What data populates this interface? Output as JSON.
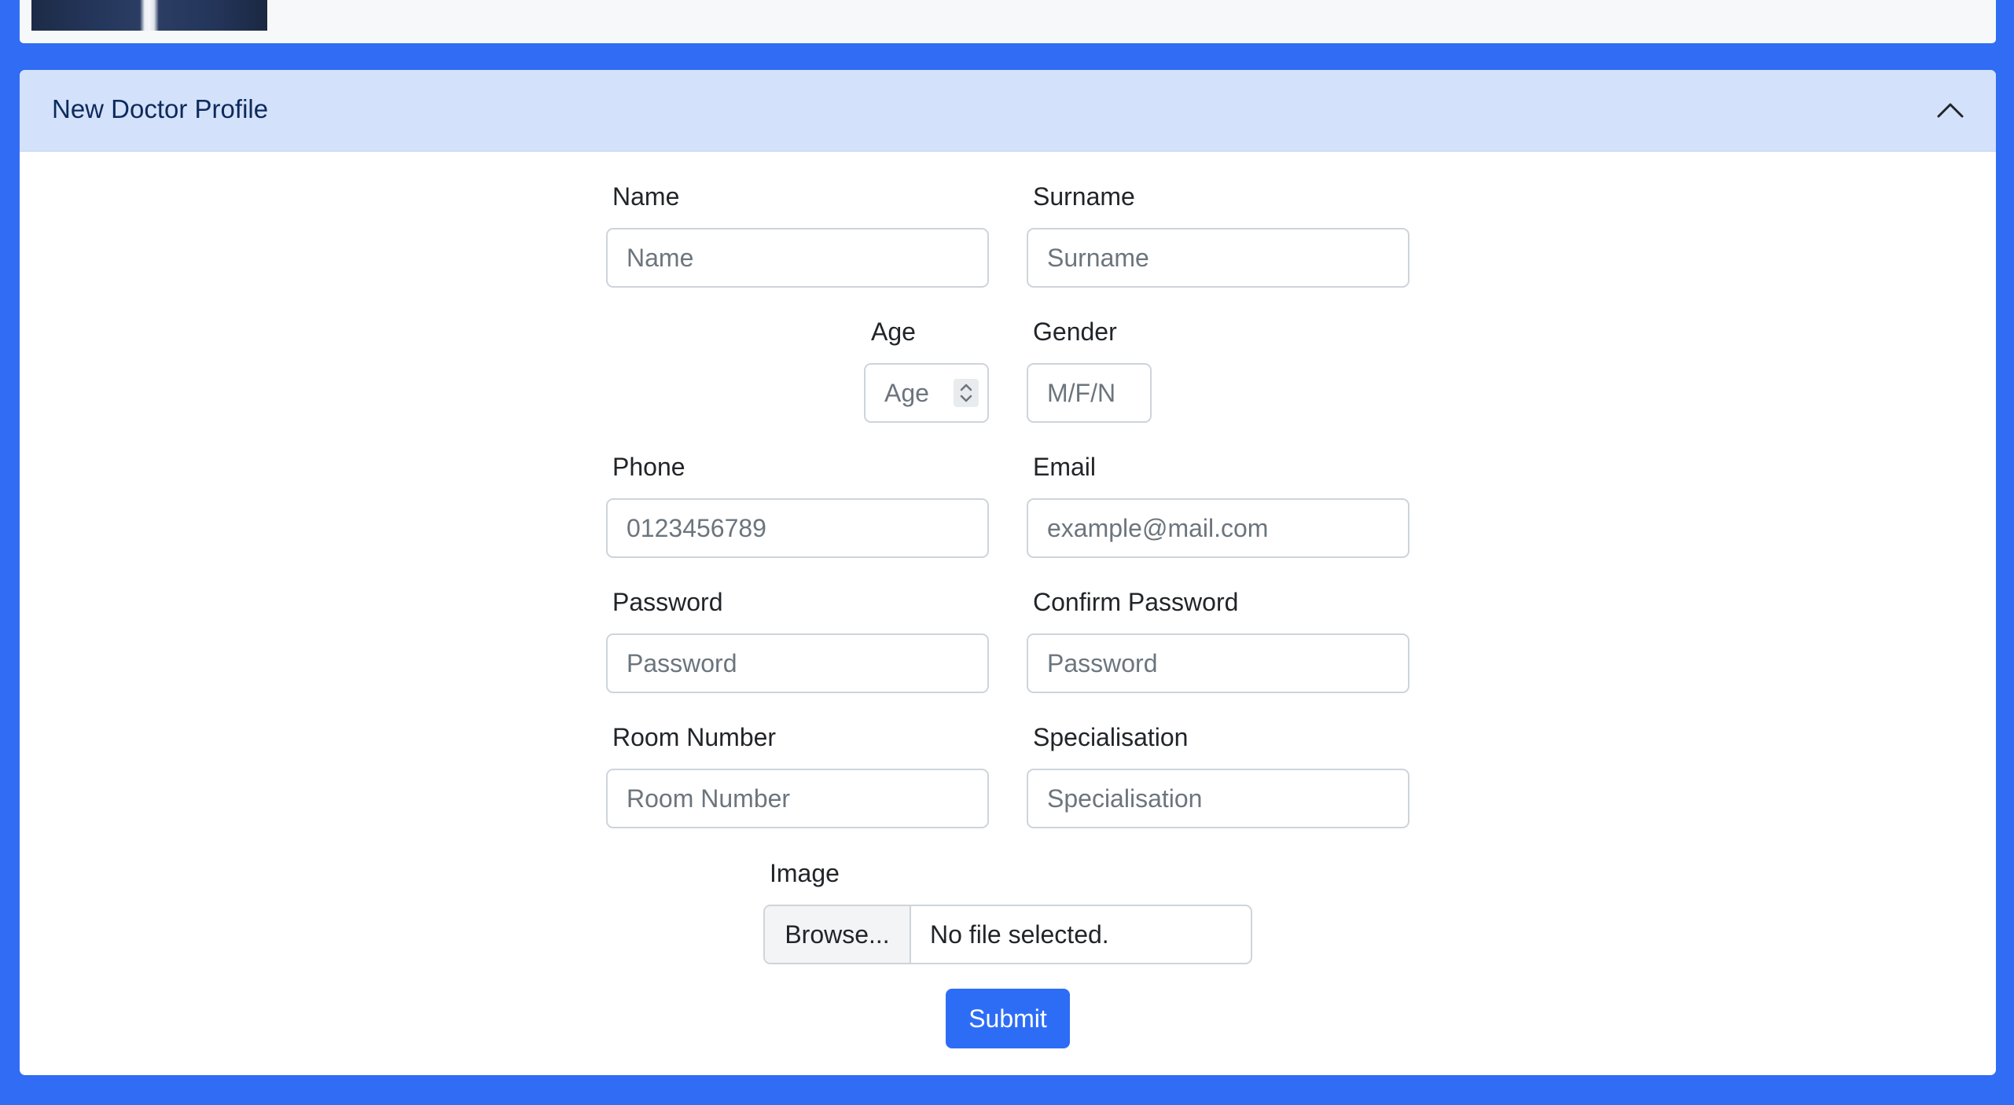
{
  "panel": {
    "title": "New Doctor Profile"
  },
  "form": {
    "name": {
      "label": "Name",
      "placeholder": "Name"
    },
    "surname": {
      "label": "Surname",
      "placeholder": "Surname"
    },
    "age": {
      "label": "Age",
      "placeholder": "Age"
    },
    "gender": {
      "label": "Gender",
      "placeholder": "M/F/N"
    },
    "phone": {
      "label": "Phone",
      "placeholder": "0123456789"
    },
    "email": {
      "label": "Email",
      "placeholder": "example@mail.com"
    },
    "password": {
      "label": "Password",
      "placeholder": "Password"
    },
    "confirm_password": {
      "label": "Confirm Password",
      "placeholder": "Password"
    },
    "room_number": {
      "label": "Room Number",
      "placeholder": "Room Number"
    },
    "specialisation": {
      "label": "Specialisation",
      "placeholder": "Specialisation"
    },
    "image": {
      "label": "Image",
      "browse_label": "Browse...",
      "status": "No file selected."
    },
    "submit_label": "Submit"
  },
  "icons": {
    "collapse": "chevron-up-icon",
    "stepper": "up-down-arrows-icon"
  },
  "colors": {
    "page_background": "#316cf4",
    "panel_header": "#d3e1fa",
    "title_text": "#0d2a5c",
    "primary_button": "#2d6df6",
    "input_border": "#ced4da"
  }
}
